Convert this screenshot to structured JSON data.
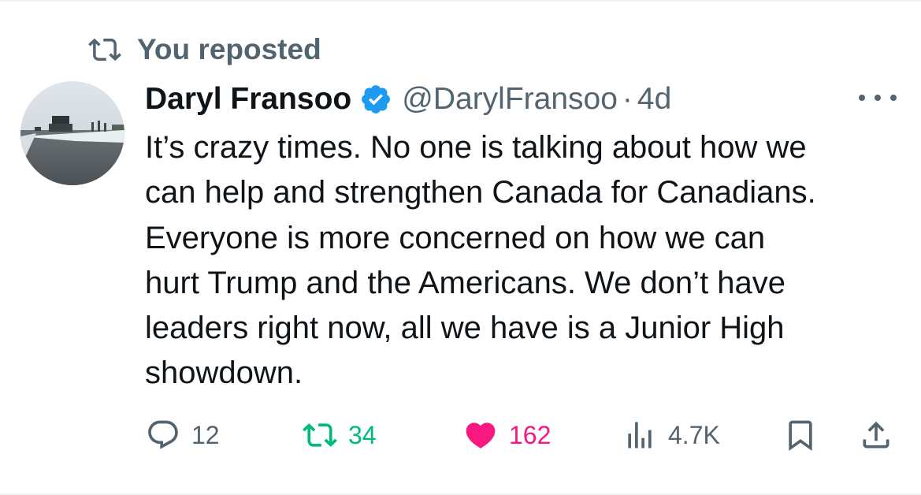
{
  "repost_banner": {
    "text": "You reposted",
    "icon": "repost-icon"
  },
  "author": {
    "name": "Daryl Fransoo",
    "verified_icon": "verified-badge-icon",
    "handle": "@DarylFransoo",
    "separator": "·",
    "time": "4d"
  },
  "post": {
    "lines": [
      "It’s crazy times. No one is talking about how we",
      "can help and strengthen Canada for Canadians.",
      "Everyone is more concerned on how we can",
      "hurt Trump and the Americans. We don’t have",
      "leaders right now, all we have is a Junior High",
      "showdown."
    ]
  },
  "actions": {
    "replies": "12",
    "reposts": "34",
    "likes": "162",
    "views": "4.7K"
  },
  "colors": {
    "text": "#0f1419",
    "secondary": "#536471",
    "verified": "#1d9bf0",
    "repost_active": "#00ba7c",
    "like_active": "#f91880"
  }
}
